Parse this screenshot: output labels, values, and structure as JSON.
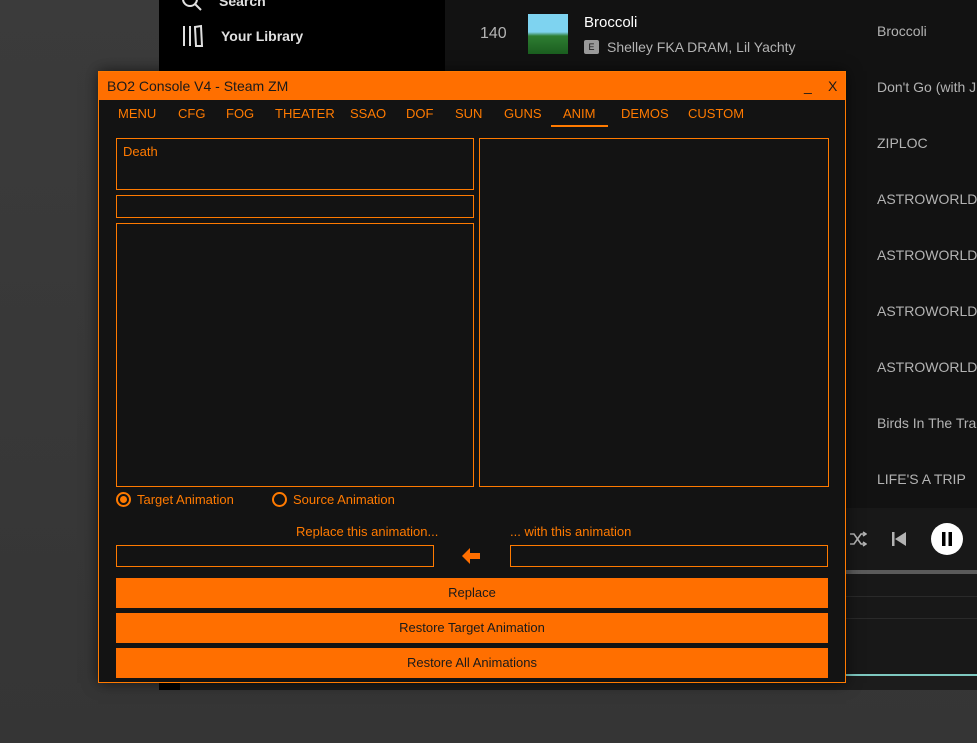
{
  "background_app": {
    "sidebar": {
      "search_label": "Search",
      "library_label": "Your Library"
    },
    "tracks": [
      {
        "num": "140",
        "title": "Broccoli",
        "explicit": "E",
        "artist": "Shelley FKA DRAM, Lil Yachty",
        "album": "Broccoli"
      },
      {
        "album": "Don't Go (with J"
      },
      {
        "album": "ZIPLOC"
      },
      {
        "album": "ASTROWORLD"
      },
      {
        "album": "ASTROWORLD"
      },
      {
        "album": "ASTROWORLD"
      },
      {
        "album": "ASTROWORLD"
      },
      {
        "album": "Birds In The Trap"
      },
      {
        "album": "LIFE'S A TRIP"
      }
    ],
    "player": {
      "shuffle_icon": "shuffle-icon",
      "prev_icon": "previous-icon",
      "pause_icon": "pause-icon"
    }
  },
  "console": {
    "title": "BO2 Console V4 - Steam ZM",
    "minimize": "_",
    "close": "X",
    "tabs": [
      "MENU",
      "CFG",
      "FOG",
      "THEATER",
      "SSAO",
      "DOF",
      "SUN",
      "GUNS",
      "ANIM",
      "DEMOS",
      "CUSTOM"
    ],
    "active_tab": "ANIM",
    "category_text": "Death",
    "radio_target": "Target Animation",
    "radio_source": "Source Animation",
    "radio_selected": "target",
    "replace_label": "Replace this animation...",
    "with_label": "... with this animation",
    "replace_value": "",
    "with_value": "",
    "buttons": {
      "replace": "Replace",
      "restore_target": "Restore Target Animation",
      "restore_all": "Restore All Animations"
    },
    "colors": {
      "accent": "#ff6f00",
      "background": "#131313"
    }
  }
}
